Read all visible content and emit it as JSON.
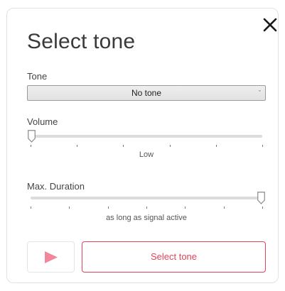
{
  "dialog": {
    "title": "Select tone",
    "close_icon": "close-icon"
  },
  "tone": {
    "label": "Tone",
    "selected": "No tone",
    "arrow_icon": "chevron-down-icon"
  },
  "volume": {
    "label": "Volume",
    "value_text": "Low",
    "level": 0,
    "tick_count": 6
  },
  "duration": {
    "label": "Max. Duration",
    "value_text": "as long as signal active",
    "level": 1,
    "tick_count": 7
  },
  "actions": {
    "play_icon": "play-icon",
    "select_label": "Select tone"
  },
  "colors": {
    "accent": "#e0455a",
    "play_icon": "#f1879a",
    "text": "#3a3a3a"
  }
}
